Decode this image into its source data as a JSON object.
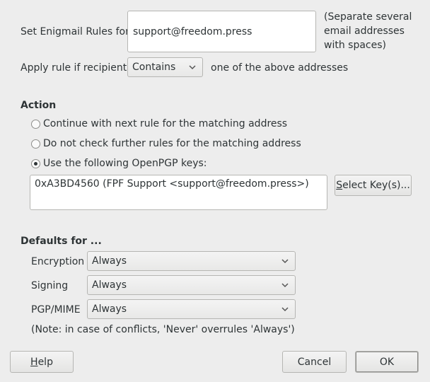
{
  "rules": {
    "set_label": "Set Enigmail Rules for",
    "email_value": "support@freedom.press",
    "hint_line1": "(Separate several",
    "hint_line2": "email addresses",
    "hint_line3": "with spaces)",
    "apply_label": "Apply rule if recipient",
    "match_value": "Contains",
    "apply_suffix": "one of the above addresses"
  },
  "action": {
    "heading": "Action",
    "options": [
      {
        "label": "Continue with next rule for the matching address",
        "selected": false
      },
      {
        "label": "Do not check further rules for the matching address",
        "selected": false
      },
      {
        "label": "Use the following OpenPGP keys:",
        "selected": true
      }
    ],
    "keys_value": "0xA3BD4560 (FPF Support <support@freedom.press>)",
    "select_keys_mnemonic": "S",
    "select_keys_rest": "elect Key(s)..."
  },
  "defaults": {
    "heading": "Defaults for ...",
    "rows": [
      {
        "label": "Encryption",
        "value": "Always"
      },
      {
        "label": "Signing",
        "value": "Always"
      },
      {
        "label": "PGP/MIME",
        "value": "Always"
      }
    ],
    "note": "(Note: in case of conflicts, 'Never' overrules 'Always')"
  },
  "buttons": {
    "help_mnemonic": "H",
    "help_rest": "elp",
    "cancel": "Cancel",
    "ok": "OK"
  },
  "icons": {
    "dropdown": "chevron-down-icon",
    "radio_dot": "radio-dot"
  },
  "colors": {
    "window_bg": "#ededed",
    "field_bg": "#ffffff",
    "text": "#2e3436",
    "border": "#b6b6b3"
  }
}
